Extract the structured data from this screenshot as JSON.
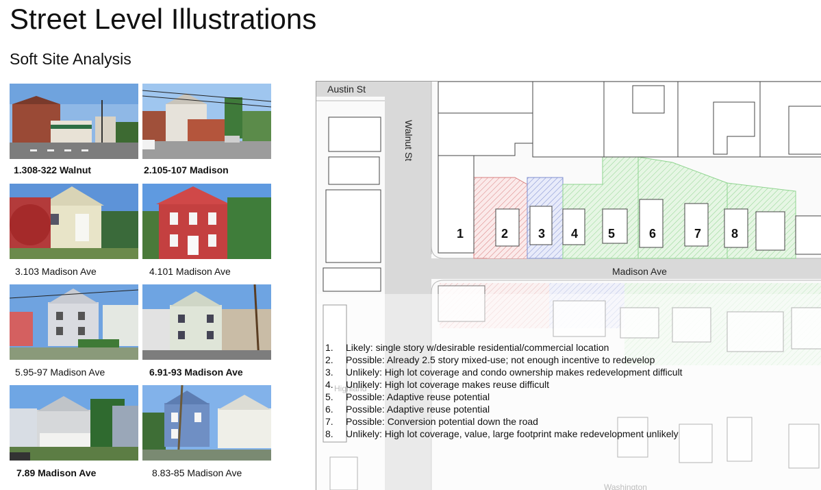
{
  "header": {
    "title": "Street Level Illustrations",
    "subtitle": "Soft Site Analysis"
  },
  "photos": [
    {
      "caption": "1.308-322 Walnut",
      "bold": true
    },
    {
      "caption": "2.105-107 Madison",
      "bold": true
    },
    {
      "caption": "3.103 Madison Ave",
      "bold": false
    },
    {
      "caption": "4.101 Madison Ave",
      "bold": false
    },
    {
      "caption": "5.95-97 Madison Ave",
      "bold": false
    },
    {
      "caption": "6.91-93 Madison Ave",
      "bold": true
    },
    {
      "caption": "7.89 Madison Ave",
      "bold": true
    },
    {
      "caption": "8.83-85 Madison Ave",
      "bold": false
    }
  ],
  "map": {
    "streets": {
      "austin": "Austin St",
      "walnut": "Walnut St",
      "madison": "Madison Ave",
      "highland": "Highland",
      "washington": "Washington"
    },
    "parcels": [
      "1",
      "2",
      "3",
      "4",
      "5",
      "6",
      "7",
      "8"
    ],
    "colors": {
      "red_hatch": "#d98080",
      "blue_hatch": "#7f8fd0",
      "green_hatch": "#8fd48f",
      "street": "#d9d9d9",
      "building": "#ffffff"
    }
  },
  "legend": [
    {
      "num": "1.",
      "text": "Likely: single story w/desirable residential/commercial location"
    },
    {
      "num": "2.",
      "text": "Possible: Already 2.5 story mixed-use; not enough incentive to redevelop"
    },
    {
      "num": "3.",
      "text": "Unlikely: High lot coverage and condo ownership makes redevelopment difficult"
    },
    {
      "num": "4.",
      "text": "Unlikely: High lot coverage makes reuse difficult"
    },
    {
      "num": "5.",
      "text": "Possible: Adaptive reuse potential"
    },
    {
      "num": "6.",
      "text": "Possible: Adaptive reuse potential"
    },
    {
      "num": "7.",
      "text": "Possible: Conversion potential down the road"
    },
    {
      "num": "8.",
      "text": "Unlikely: High lot coverage, value, large footprint make redevelopment unlikely"
    }
  ]
}
